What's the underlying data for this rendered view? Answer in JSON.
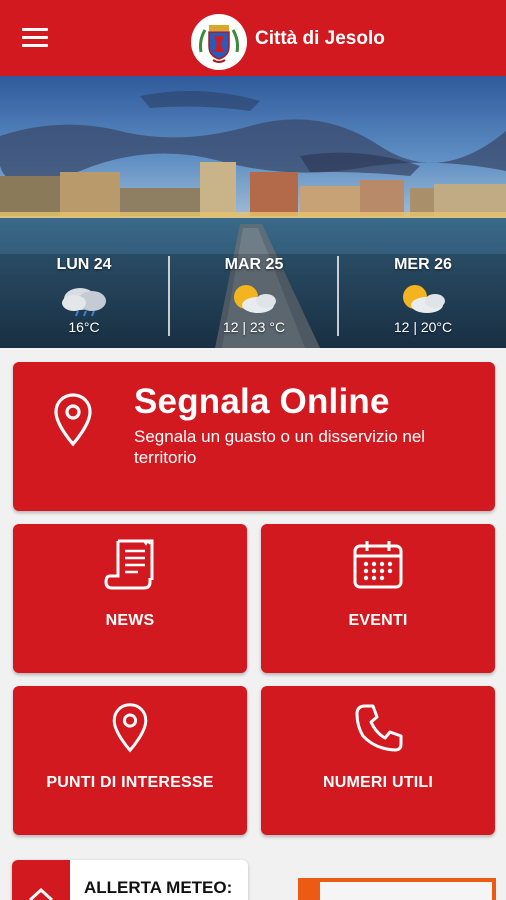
{
  "app": {
    "title": "Città di Jesolo"
  },
  "weather": [
    {
      "day": "LUN 24",
      "icon": "rain-cloud-icon",
      "temp": "16°C"
    },
    {
      "day": "MAR 25",
      "icon": "sun-cloud-icon",
      "temp": "12 | 23 °C"
    },
    {
      "day": "MER 26",
      "icon": "sun-cloud-icon",
      "temp": "12 | 20°C"
    }
  ],
  "segnala": {
    "title": "Segnala Online",
    "subtitle": "Segnala un guasto o un disservizio nel territorio",
    "icon": "location-pin-icon"
  },
  "tiles": [
    {
      "label": "NEWS",
      "icon": "news-scroll-icon"
    },
    {
      "label": "EVENTI",
      "icon": "calendar-icon"
    },
    {
      "label": "PUNTI DI INTERESSE",
      "icon": "location-pin-icon"
    },
    {
      "label": "NUMERI UTILI",
      "icon": "phone-icon"
    }
  ],
  "alert": {
    "title": "ALLERTA METEO:"
  },
  "colors": {
    "primary": "#d31920",
    "promo": "#ec5a14",
    "background": "#f1f1f1"
  }
}
